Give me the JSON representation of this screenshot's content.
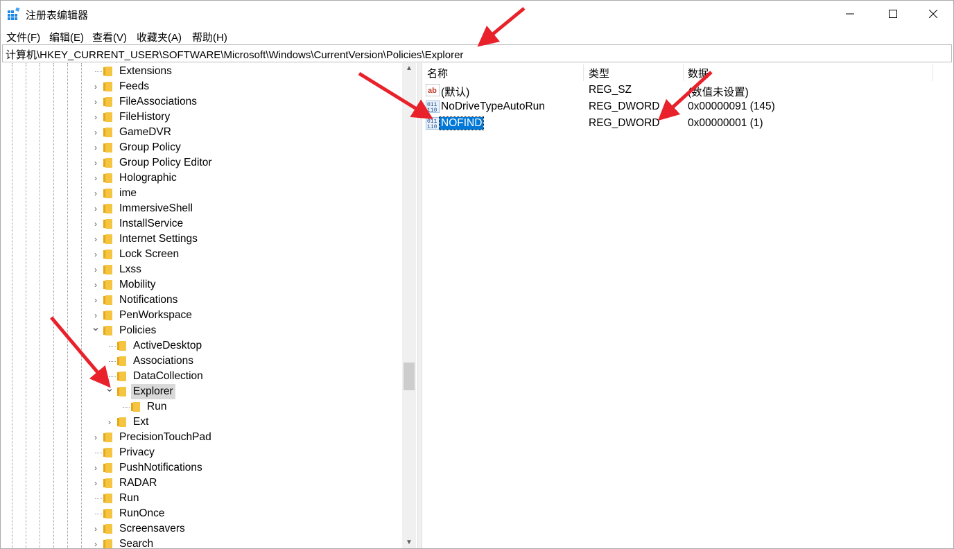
{
  "window": {
    "title": "注册表编辑器"
  },
  "menu": [
    "文件(F)",
    "编辑(E)",
    "查看(V)",
    "收藏夹(A)",
    "帮助(H)"
  ],
  "address": "计算机\\HKEY_CURRENT_USER\\SOFTWARE\\Microsoft\\Windows\\CurrentVersion\\Policies\\Explorer",
  "tree": {
    "items": [
      {
        "label": "Extensions",
        "expander": "none"
      },
      {
        "label": "Feeds",
        "expander": "collapsed"
      },
      {
        "label": "FileAssociations",
        "expander": "collapsed"
      },
      {
        "label": "FileHistory",
        "expander": "collapsed"
      },
      {
        "label": "GameDVR",
        "expander": "collapsed"
      },
      {
        "label": "Group Policy",
        "expander": "collapsed"
      },
      {
        "label": "Group Policy Editor",
        "expander": "collapsed"
      },
      {
        "label": "Holographic",
        "expander": "collapsed"
      },
      {
        "label": "ime",
        "expander": "collapsed"
      },
      {
        "label": "ImmersiveShell",
        "expander": "collapsed"
      },
      {
        "label": "InstallService",
        "expander": "collapsed"
      },
      {
        "label": "Internet Settings",
        "expander": "collapsed"
      },
      {
        "label": "Lock Screen",
        "expander": "collapsed"
      },
      {
        "label": "Lxss",
        "expander": "collapsed"
      },
      {
        "label": "Mobility",
        "expander": "collapsed"
      },
      {
        "label": "Notifications",
        "expander": "collapsed"
      },
      {
        "label": "PenWorkspace",
        "expander": "collapsed"
      },
      {
        "label": "Policies",
        "expander": "expanded"
      },
      {
        "label": "ActiveDesktop",
        "expander": "none"
      },
      {
        "label": "Associations",
        "expander": "none"
      },
      {
        "label": "DataCollection",
        "expander": "none"
      },
      {
        "label": "Explorer",
        "expander": "expanded",
        "selected": true
      },
      {
        "label": "Run",
        "expander": "none"
      },
      {
        "label": "Ext",
        "expander": "collapsed"
      },
      {
        "label": "PrecisionTouchPad",
        "expander": "collapsed"
      },
      {
        "label": "Privacy",
        "expander": "none"
      },
      {
        "label": "PushNotifications",
        "expander": "collapsed"
      },
      {
        "label": "RADAR",
        "expander": "collapsed"
      },
      {
        "label": "Run",
        "expander": "none"
      },
      {
        "label": "RunOnce",
        "expander": "none"
      },
      {
        "label": "Screensavers",
        "expander": "collapsed"
      },
      {
        "label": "Search",
        "expander": "collapsed"
      }
    ]
  },
  "list": {
    "headers": {
      "name": "名称",
      "type": "类型",
      "data": "数据"
    },
    "rows": [
      {
        "icon": "string-value-icon",
        "name": "(默认)",
        "type": "REG_SZ",
        "data": "(数值未设置)"
      },
      {
        "icon": "dword-value-icon",
        "name": "NoDriveTypeAutoRun",
        "type": "REG_DWORD",
        "data": "0x00000091 (145)"
      },
      {
        "icon": "dword-value-icon",
        "name": "NOFIND",
        "type": "REG_DWORD",
        "data": "0x00000001 (1)",
        "selected": true
      }
    ]
  },
  "colors": {
    "selection": "#0078d7",
    "annotation_arrow": "#e8212b",
    "folder": "#f5c542"
  }
}
